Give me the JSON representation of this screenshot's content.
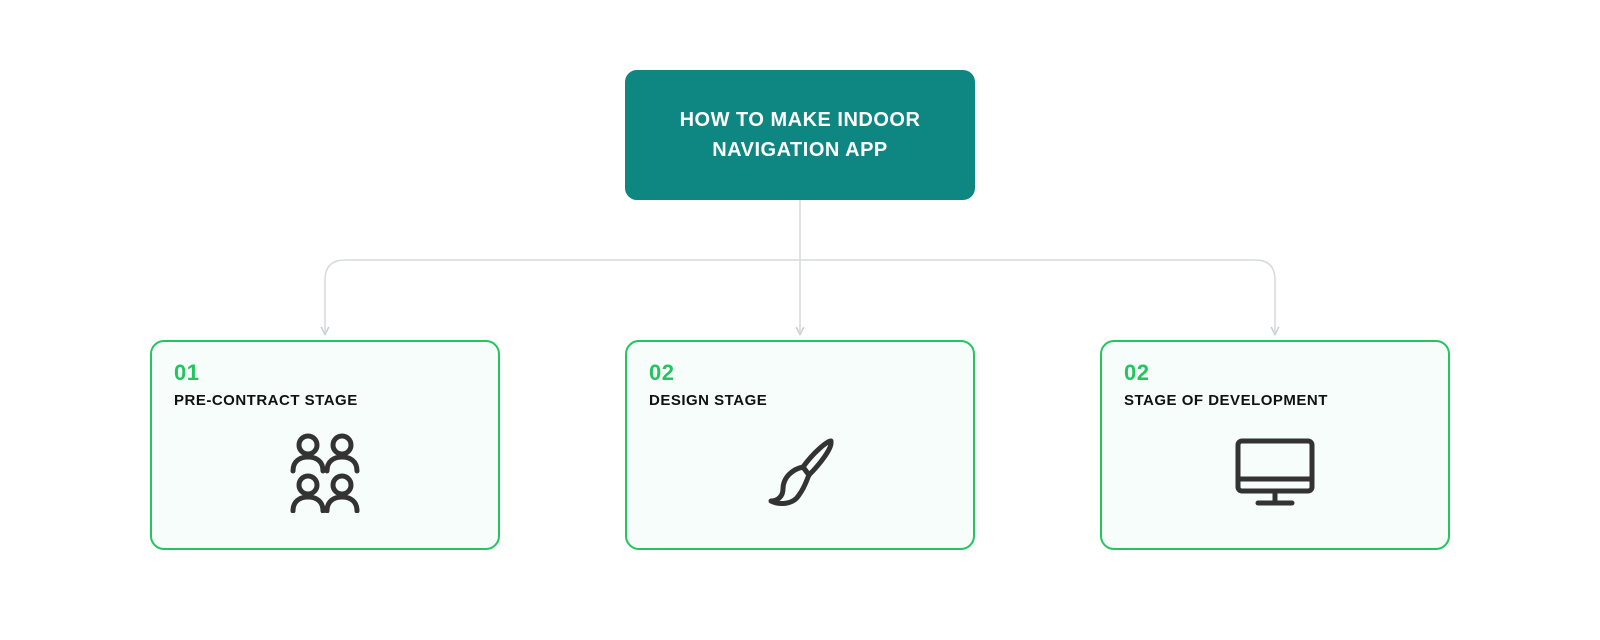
{
  "header": {
    "title": "HOW TO MAKE INDOOR NAVIGATION APP"
  },
  "cards": [
    {
      "number": "01",
      "title": "PRE-CONTRACT STAGE",
      "icon": "people-icon"
    },
    {
      "number": "02",
      "title": "DESIGN STAGE",
      "icon": "brush-icon"
    },
    {
      "number": "02",
      "title": "STAGE OF DEVELOPMENT",
      "icon": "monitor-icon"
    }
  ],
  "colors": {
    "accent_green": "#22c55e",
    "header_bg": "#0e8782",
    "card_bg": "#f7fdfa",
    "connector": "#d6d9de",
    "icon_stroke": "#333333"
  }
}
